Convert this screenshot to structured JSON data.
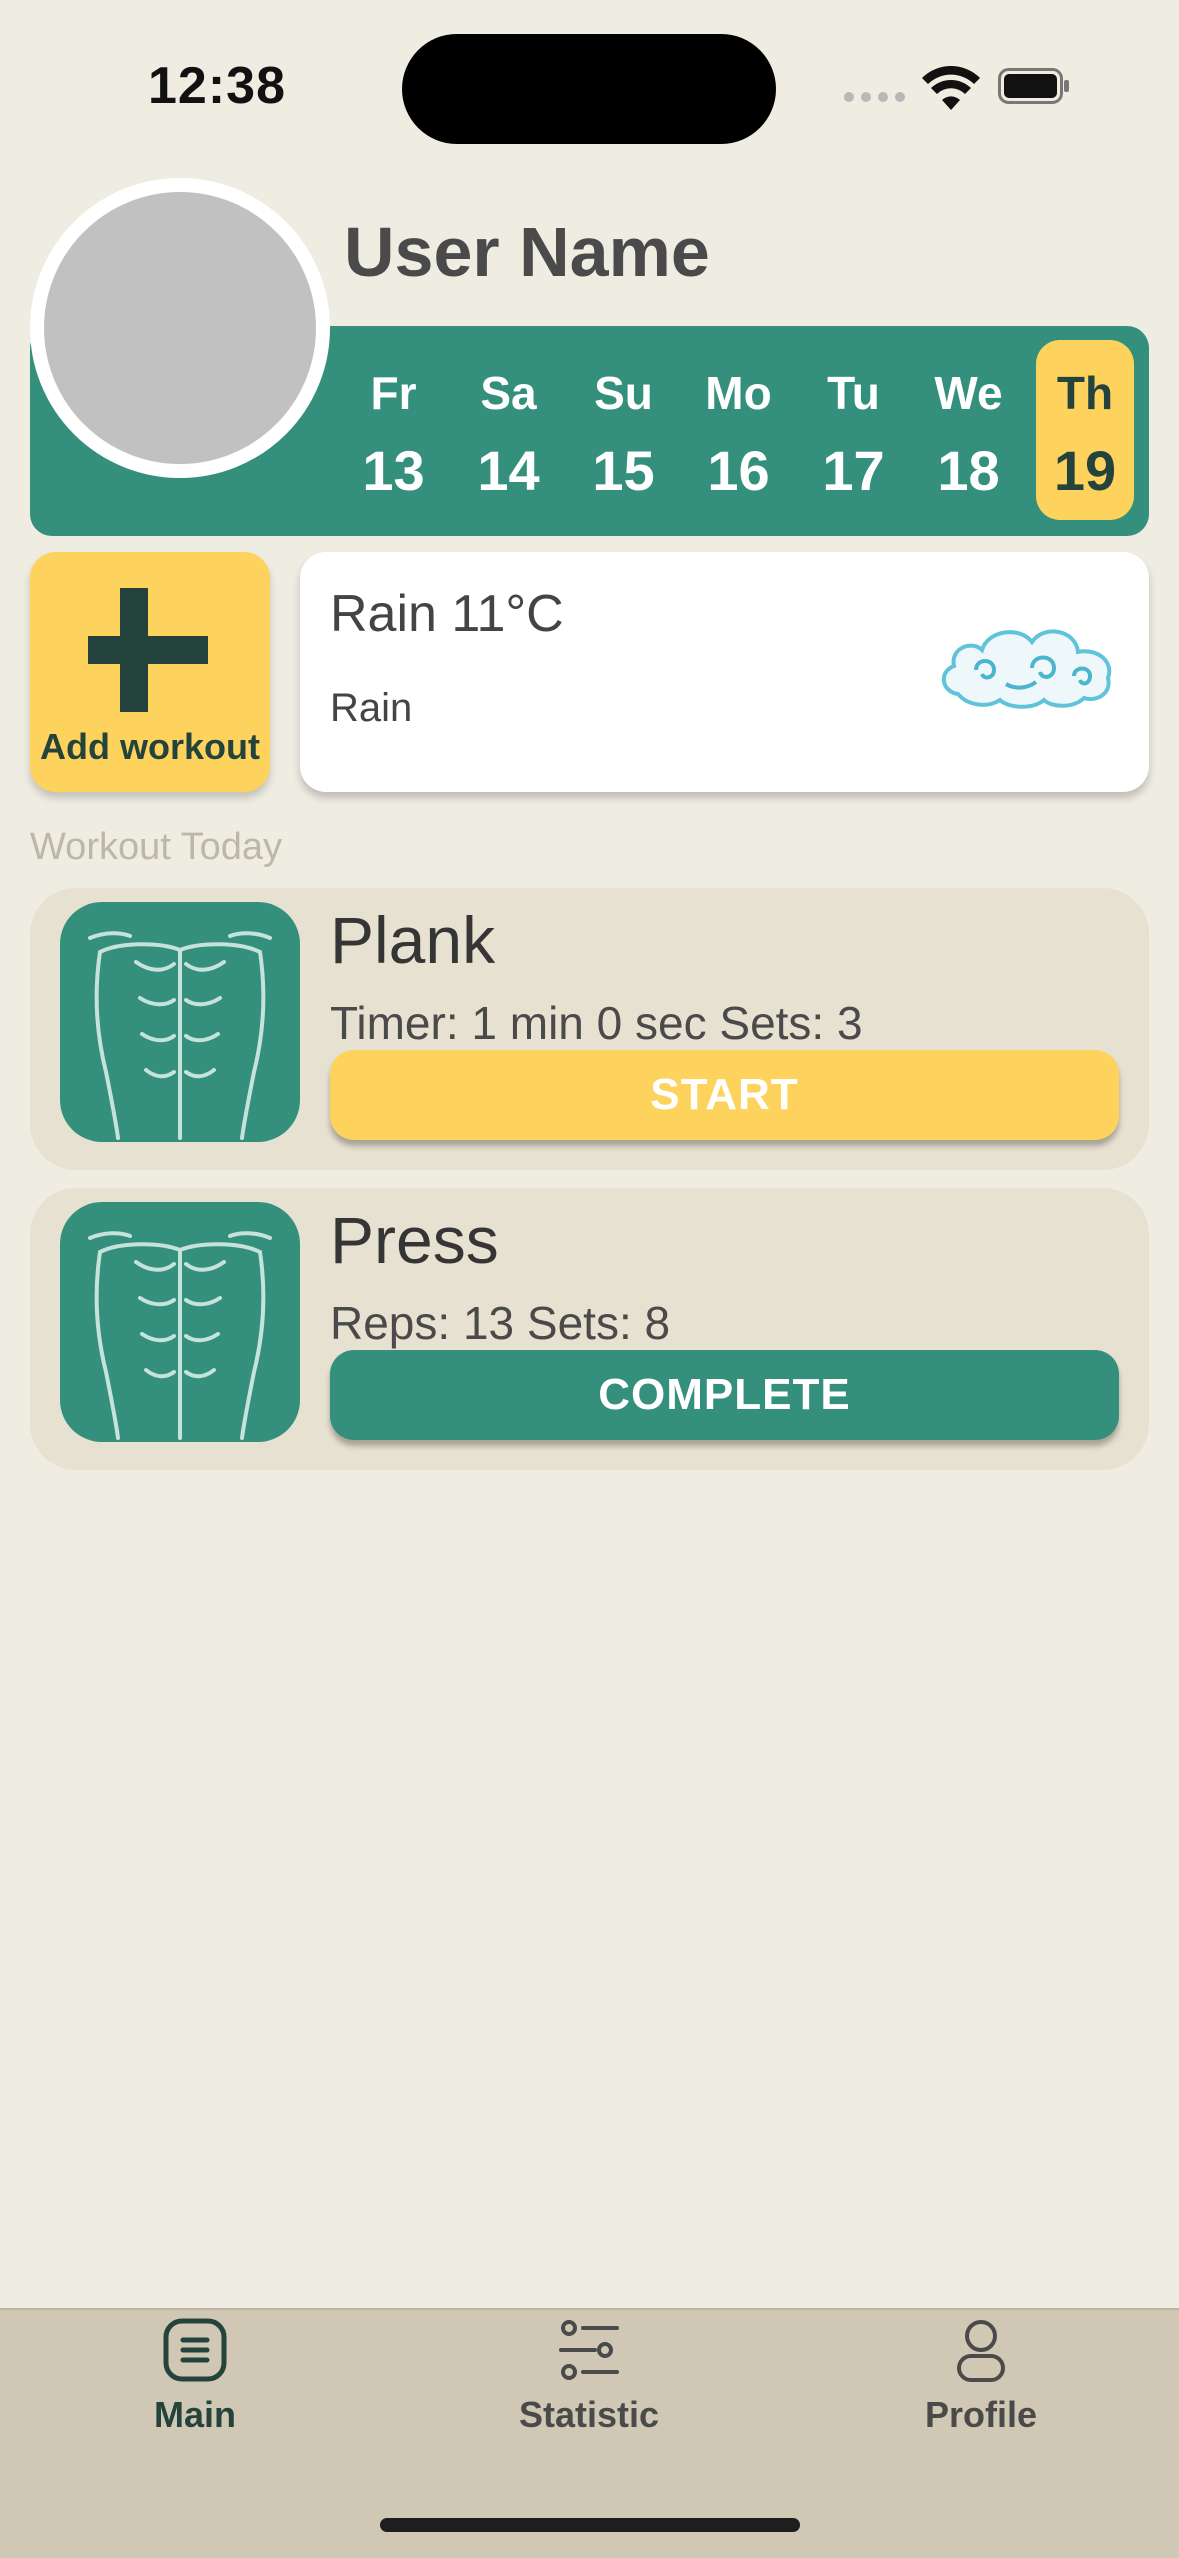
{
  "status_bar": {
    "time": "12:38"
  },
  "header": {
    "user_name": "User Name"
  },
  "week": [
    {
      "name": "Fr",
      "date": "13"
    },
    {
      "name": "Sa",
      "date": "14"
    },
    {
      "name": "Su",
      "date": "15"
    },
    {
      "name": "Mo",
      "date": "16"
    },
    {
      "name": "Tu",
      "date": "17"
    },
    {
      "name": "We",
      "date": "18"
    },
    {
      "name": "Th",
      "date": "19",
      "selected": true
    }
  ],
  "add_workout": {
    "label": "Add workout"
  },
  "weather": {
    "title": "Rain 11°C",
    "description": "Rain",
    "icon": "cloud-icon"
  },
  "section_title": "Workout Today",
  "workouts": [
    {
      "name": "Plank",
      "info": "Timer: 1 min 0 sec Sets: 3",
      "button": "START",
      "icon": "abs-icon"
    },
    {
      "name": "Press",
      "info": "Reps: 13 Sets: 8",
      "button": "COMPLETE",
      "icon": "abs-icon"
    }
  ],
  "tabs": [
    {
      "label": "Main",
      "icon": "list-icon",
      "active": true
    },
    {
      "label": "Statistic",
      "icon": "sliders-icon"
    },
    {
      "label": "Profile",
      "icon": "person-icon"
    }
  ],
  "colors": {
    "background": "#efece2",
    "green": "#34907c",
    "yellow": "#fdd35d",
    "dark_green": "#24433c",
    "card": "#e7e1d1",
    "tabbar": "#d0c8b4"
  }
}
